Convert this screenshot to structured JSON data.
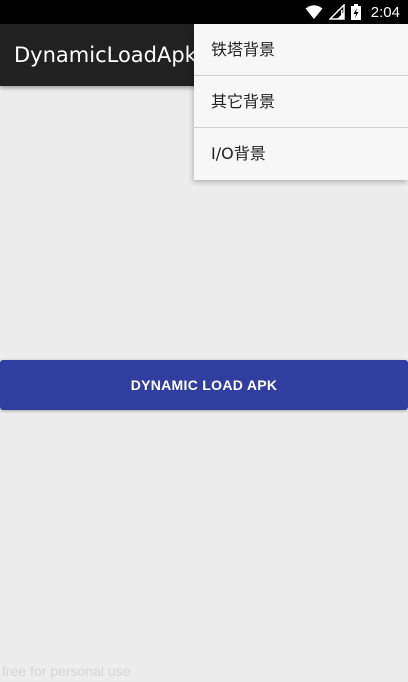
{
  "status_bar": {
    "time": "2:04",
    "icons": [
      "wifi-icon",
      "cell-signal-icon",
      "battery-charging-icon"
    ]
  },
  "app_bar": {
    "title": "DynamicLoadApk"
  },
  "overflow_menu": {
    "items": [
      {
        "label": "铁塔背景"
      },
      {
        "label": "其它背景"
      },
      {
        "label": "I/O背景"
      }
    ]
  },
  "main": {
    "load_button_label": "DYNAMIC LOAD APK"
  },
  "watermark": "free for personal use",
  "colors": {
    "status_bar": "#000000",
    "app_bar": "#212121",
    "menu_background": "#f7f7f7",
    "button": "#303f9f",
    "page_background": "#ececec"
  }
}
